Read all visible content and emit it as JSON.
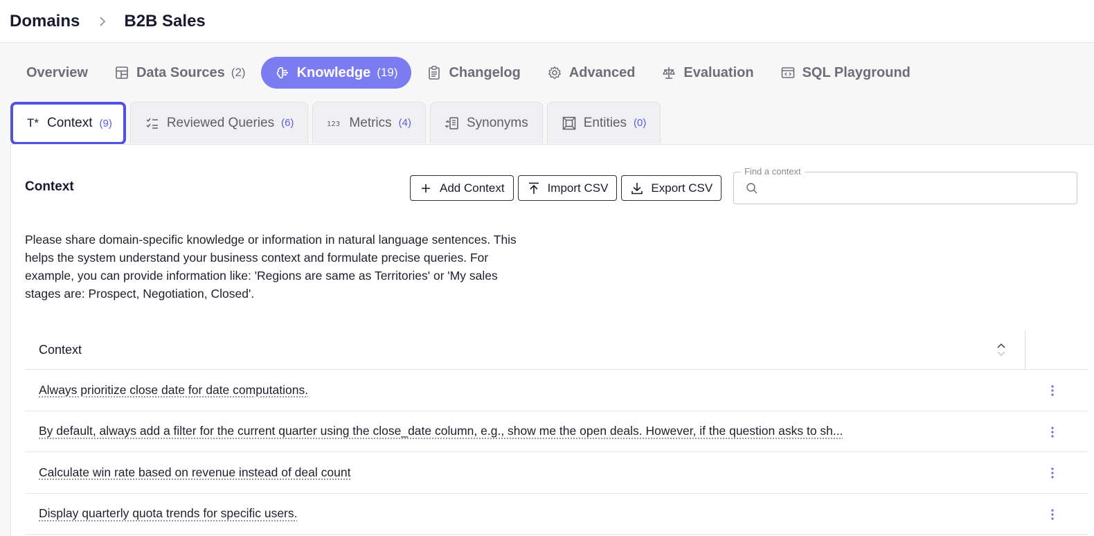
{
  "breadcrumb": {
    "root": "Domains",
    "current": "B2B Sales"
  },
  "main_tabs": [
    {
      "label": "Overview",
      "count": ""
    },
    {
      "label": "Data Sources",
      "count": "(2)"
    },
    {
      "label": "Knowledge",
      "count": "(19)"
    },
    {
      "label": "Changelog",
      "count": ""
    },
    {
      "label": "Advanced",
      "count": ""
    },
    {
      "label": "Evaluation",
      "count": ""
    },
    {
      "label": "SQL Playground",
      "count": ""
    }
  ],
  "sub_tabs": [
    {
      "label": "Context",
      "count": "(9)",
      "icon_text": "T*"
    },
    {
      "label": "Reviewed Queries",
      "count": "(6)"
    },
    {
      "label": "Metrics",
      "count": "(4)"
    },
    {
      "label": "Synonyms",
      "count": ""
    },
    {
      "label": "Entities",
      "count": "(0)"
    }
  ],
  "panel": {
    "title": "Context",
    "add_label": "Add Context",
    "import_label": "Import CSV",
    "export_label": "Export CSV",
    "search_label": "Find a context",
    "search_value": "",
    "description": "Please share domain-specific knowledge or information in natural language sentences. This helps the system understand your business context and formulate precise queries. For example, you can provide information like: 'Regions are same as Territories' or 'My sales stages are: Prospect, Negotiation, Closed'."
  },
  "table": {
    "header": "Context",
    "rows": [
      "Always prioritize close date for date computations.",
      "By default, always add a filter for the current quarter using the close_date column, e.g., show me the open deals. However, if the question asks to sh...",
      "Calculate win rate based on revenue instead of deal count",
      "Display quarterly quota trends for specific users."
    ]
  },
  "colors": {
    "accent": "#7b7cf0",
    "active_border": "#5252e0",
    "count_text": "#5b5be8"
  }
}
